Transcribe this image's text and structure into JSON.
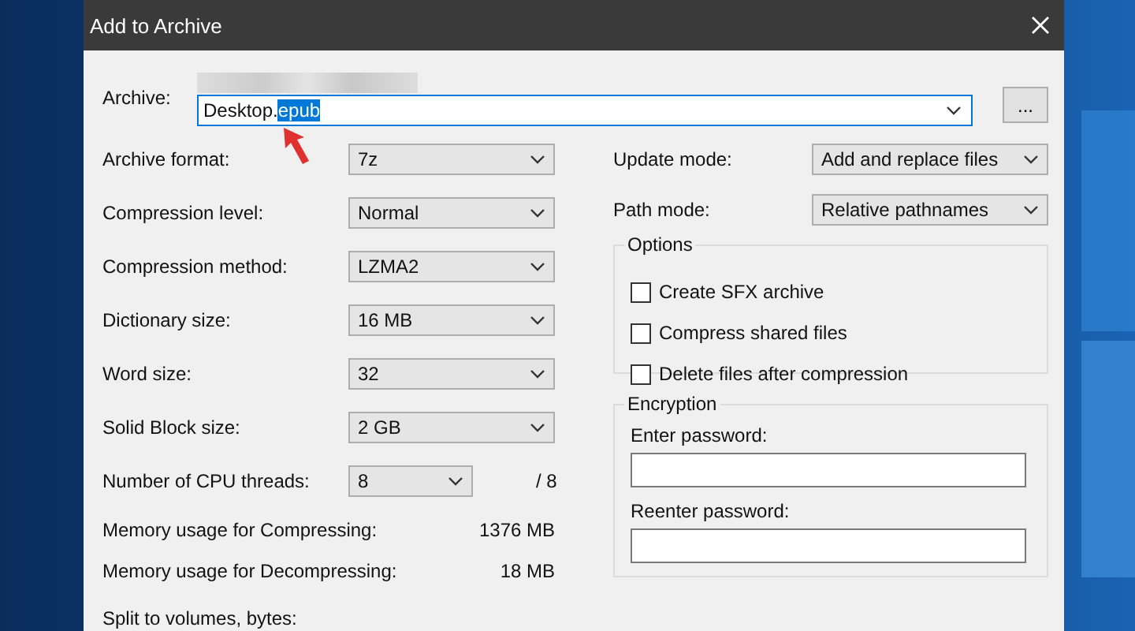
{
  "window": {
    "title": "Add to Archive"
  },
  "archive": {
    "label": "Archive:",
    "value": "Desktop.",
    "selected_text": "epub",
    "browse_button": "..."
  },
  "left_fields": [
    {
      "label": "Archive format:",
      "value": "7z"
    },
    {
      "label": "Compression level:",
      "value": "Normal"
    },
    {
      "label": "Compression method:",
      "value": "LZMA2"
    },
    {
      "label": "Dictionary size:",
      "value": "16 MB"
    },
    {
      "label": "Word size:",
      "value": "32"
    },
    {
      "label": "Solid Block size:",
      "value": "2 GB"
    }
  ],
  "cpu_threads": {
    "label": "Number of CPU threads:",
    "value": "8",
    "max": "/ 8"
  },
  "memory": [
    {
      "label": "Memory usage for Compressing:",
      "value": "1376 MB"
    },
    {
      "label": "Memory usage for Decompressing:",
      "value": "18 MB"
    }
  ],
  "split": {
    "label": "Split to volumes, bytes:"
  },
  "right_fields": [
    {
      "label": "Update mode:",
      "value": "Add and replace files"
    },
    {
      "label": "Path mode:",
      "value": "Relative pathnames"
    }
  ],
  "options": {
    "title": "Options",
    "items": [
      {
        "label": "Create SFX archive",
        "checked": false
      },
      {
        "label": "Compress shared files",
        "checked": false
      },
      {
        "label": "Delete files after compression",
        "checked": false
      }
    ]
  },
  "encryption": {
    "title": "Encryption",
    "fields": [
      {
        "label": "Enter password:"
      },
      {
        "label": "Reenter password:"
      }
    ]
  }
}
